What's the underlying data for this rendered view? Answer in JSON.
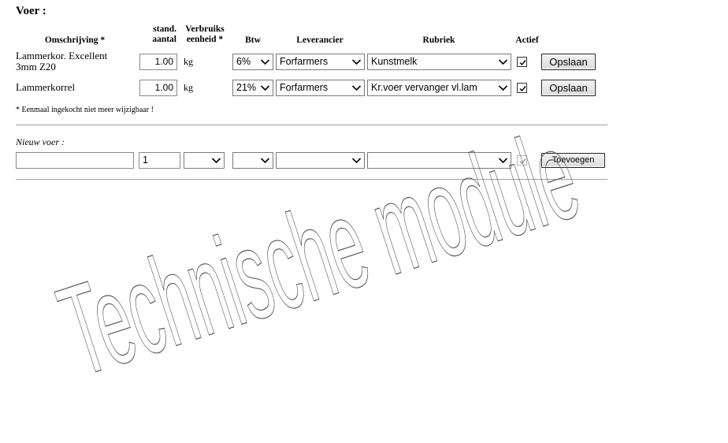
{
  "page": {
    "title": "Voer :"
  },
  "table": {
    "headers": {
      "omschrijving": "Omschrijving *",
      "stand_line1": "stand.",
      "stand_line2": "aantal",
      "verbruik_line1": "Verbruiks",
      "verbruik_line2": "eenheid *",
      "btw": "Btw",
      "leverancier": "Leverancier",
      "rubriek": "Rubriek",
      "actief": "Actief"
    },
    "rows": [
      {
        "desc_line1": "Lammerkor. Excellent",
        "desc_line2": "3mm Z20",
        "aantal": "1.00",
        "eenheid": "kg",
        "btw": "6%",
        "leverancier": "Forfarmers",
        "rubriek": "Kunstmelk",
        "actief": true,
        "save_label": "Opslaan"
      },
      {
        "desc_line1": "Lammerkorrel",
        "desc_line2": "",
        "aantal": "1.00",
        "eenheid": "kg",
        "btw": "21%",
        "leverancier": "Forfarmers",
        "rubriek": "Kr.voer vervanger vl.lam",
        "actief": true,
        "save_label": "Opslaan"
      }
    ]
  },
  "note": "* Eenmaal ingekocht niet meer wijzigbaar !",
  "new_entry": {
    "label": "Nieuw voer :",
    "omschrijving": "",
    "aantal": "1",
    "eenheid": "",
    "btw": "",
    "leverancier": "",
    "rubriek": "",
    "actief": true,
    "add_label": "Toevoegen"
  },
  "watermark": {
    "text": "Technische module",
    "icon": "outlined-rotated-text"
  }
}
